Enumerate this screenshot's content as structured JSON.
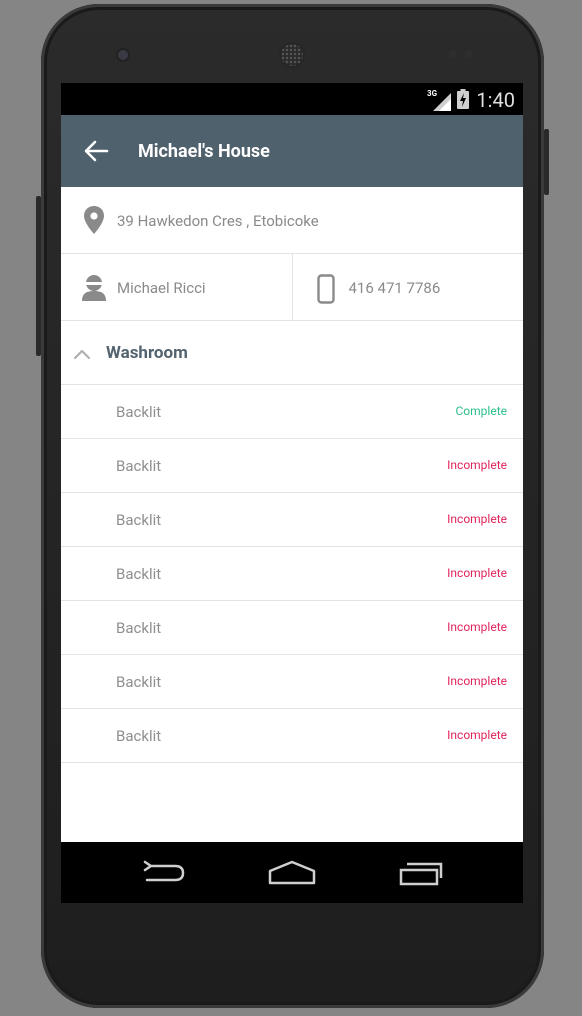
{
  "status_bar": {
    "network": "3G",
    "time": "1:40"
  },
  "toolbar": {
    "title": "Michael's House"
  },
  "address": {
    "text": "39 Hawkedon Cres , Etobicoke"
  },
  "contact": {
    "name": "Michael Ricci",
    "phone": "416 471 7786"
  },
  "section": {
    "label": "Washroom"
  },
  "items": [
    {
      "name": "Backlit",
      "status": "Complete"
    },
    {
      "name": "Backlit",
      "status": "Incomplete"
    },
    {
      "name": "Backlit",
      "status": "Incomplete"
    },
    {
      "name": "Backlit",
      "status": "Incomplete"
    },
    {
      "name": "Backlit",
      "status": "Incomplete"
    },
    {
      "name": "Backlit",
      "status": "Incomplete"
    },
    {
      "name": "Backlit",
      "status": "Incomplete"
    }
  ],
  "colors": {
    "toolbar": "#4f616c",
    "complete": "#2bbf8a",
    "incomplete": "#e0255c",
    "section_label": "#536470"
  }
}
